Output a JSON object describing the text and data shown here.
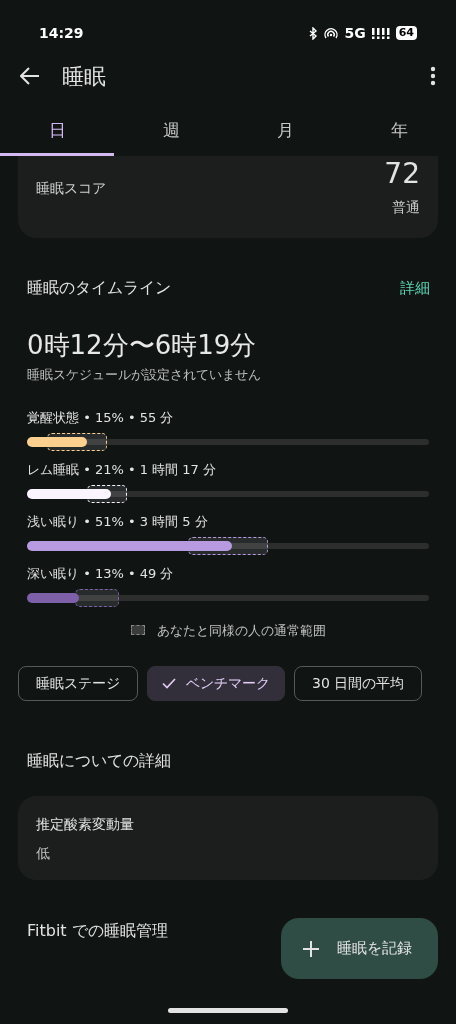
{
  "status_bar": {
    "time": "14:29",
    "network": "5G",
    "battery": "64"
  },
  "app_bar": {
    "title": "睡眠"
  },
  "tabs": [
    {
      "label": "日",
      "selected": true
    },
    {
      "label": "週",
      "selected": false
    },
    {
      "label": "月",
      "selected": false
    },
    {
      "label": "年",
      "selected": false
    }
  ],
  "score_card": {
    "label": "睡眠スコア",
    "value": "72",
    "rating": "普通"
  },
  "timeline": {
    "title": "睡眠のタイムライン",
    "link": "詳細",
    "time_range": "0時12分〜6時19分",
    "note": "睡眠スケジュールが設定されていません",
    "stages": [
      {
        "label": "覚醒状態 • 15% • 55 分",
        "level": 0.15,
        "color": "#fdd08f"
      },
      {
        "label": "レム睡眠 • 21% • 1 時間 17 分",
        "level": 0.21,
        "color": "#fbf5ff"
      },
      {
        "label": "浅い眠り • 51% • 3 時間 5 分",
        "level": 0.51,
        "color": "#b79ae0"
      },
      {
        "label": "深い眠り • 13% • 49 分",
        "level": 0.13,
        "color": "#7d60a8"
      }
    ],
    "legend": "あなたと同様の人の通常範囲"
  },
  "chips": [
    {
      "label": "睡眠ステージ",
      "selected": false
    },
    {
      "label": "ベンチマーク",
      "selected": true
    },
    {
      "label": "30 日間の平均",
      "selected": false
    }
  ],
  "details": {
    "title": "睡眠についての詳細",
    "card": {
      "label": "推定酸素変動量",
      "value": "低"
    }
  },
  "fitbit_section": {
    "title": "Fitbit での睡眠管理"
  },
  "fab": {
    "label": "睡眠を記録"
  }
}
